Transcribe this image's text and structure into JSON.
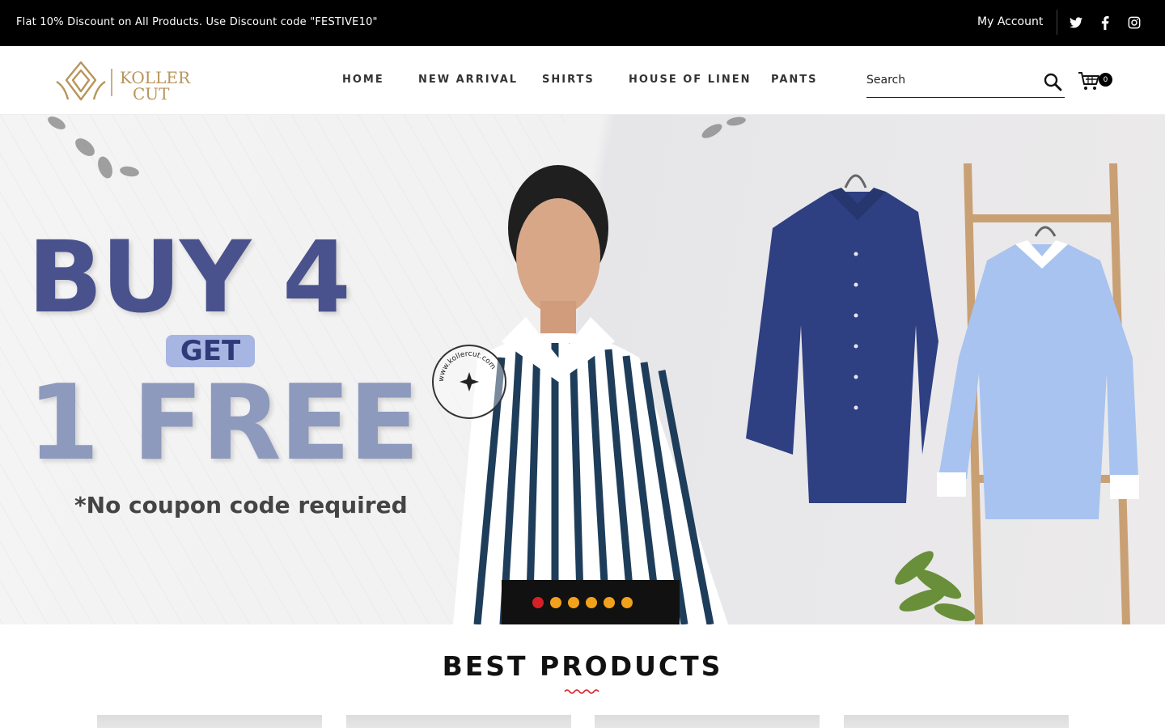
{
  "topbar": {
    "promo": "Flat 10% Discount on All Products. Use Discount code \"FESTIVE10\"",
    "account": "My Account",
    "social": [
      "twitter-icon",
      "facebook-icon",
      "instagram-icon"
    ]
  },
  "brand": {
    "line1": "KOLLER",
    "line2": "CUT",
    "color": "#b8955a"
  },
  "nav": {
    "items": [
      {
        "label": "HOME"
      },
      {
        "label": "NEW ARRIVAL"
      },
      {
        "label": "SHIRTS"
      },
      {
        "label": "HOUSE OF LINEN"
      },
      {
        "label": "PANTS"
      }
    ]
  },
  "search": {
    "placeholder": "Search"
  },
  "cart": {
    "count": "0"
  },
  "hero": {
    "headline_1": "BUY 4",
    "get": "GET",
    "headline_2": "1 FREE",
    "note": "*No coupon code required",
    "stamp_text": "www.kollercut.com",
    "slides": 6,
    "active_slide": 1,
    "colors": {
      "primary": "#49528c",
      "secondary": "#8d99bd",
      "dot": "#f2a11d",
      "dot_active": "#d42127"
    }
  },
  "section": {
    "title": "BEST PRODUCTS"
  }
}
